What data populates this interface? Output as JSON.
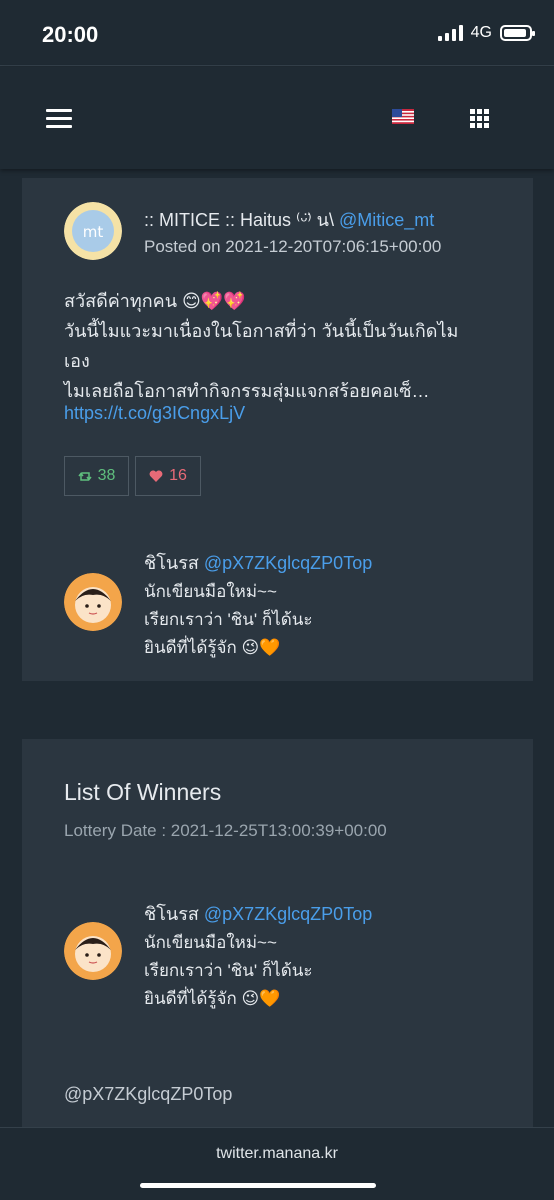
{
  "status_bar": {
    "time": "20:00",
    "network": "4G"
  },
  "navbar": {
    "flag_icon": "us-flag-icon",
    "apps_icon": "grid-icon",
    "menu_icon": "hamburger-icon"
  },
  "post": {
    "author_name": ":: MITICE :: Haitus ⁽ᵕ̈⁾ น\\",
    "author_handle": "@Mitice_mt",
    "posted_on": "Posted on 2021-12-20T07:06:15+00:00",
    "body_lines": [
      "สวัสดีค่าทุกคน 😊💖💖",
      "วันนี้ไมแวะมาเนื่องในโอกาสที่ว่า วันนี้เป็นวันเกิดไม",
      "เอง",
      "ไมเลยถือโอกาสทำกิจกรรมสุ่มแจกสร้อยคอเซ็…"
    ],
    "link": "https://t.co/g3ICngxLjV",
    "retweets": "38",
    "likes": "16"
  },
  "participant": {
    "name": "ชิโนรส",
    "handle": "@pX7ZKglcqZP0Top",
    "bio_lines": [
      "นักเขียนมือใหม่~~",
      "เรียกเราว่า 'ชิน' ก็ได้นะ",
      "ยินดีที่ได้รู้จัก 😉🧡"
    ]
  },
  "winners": {
    "title": "List Of Winners",
    "lottery_date": "Lottery Date : 2021-12-25T13:00:39+00:00",
    "winner_name": "ชิโนรส",
    "winner_handle_link": "@pX7ZKglcqZP0Top",
    "winner_bio_lines": [
      "นักเขียนมือใหม่~~",
      "เรียกเราว่า 'ชิน' ก็ได้นะ",
      "ยินดีที่ได้รู้จัก 😉🧡"
    ],
    "winner_handle": "@pX7ZKglcqZP0Top"
  },
  "footer": {
    "domain": "twitter.manana.kr"
  },
  "colors": {
    "background": "#1f2a33",
    "card": "#2b3640",
    "link": "#4a9eea",
    "retweet": "#5fbf7e",
    "like": "#e86a77"
  }
}
